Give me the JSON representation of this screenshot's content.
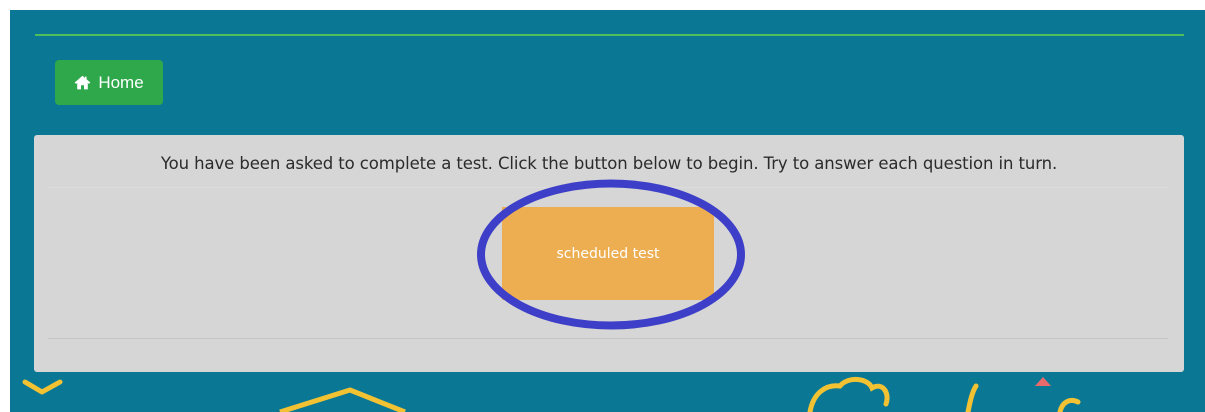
{
  "nav": {
    "home_label": "Home",
    "home_icon": "home-icon"
  },
  "panel": {
    "instruction": "You have been asked to complete a test. Click the button below to begin. Try to answer each question in turn.",
    "start_button_label": "scheduled test"
  },
  "colors": {
    "background": "#0a7895",
    "accent_green": "#2ea84a",
    "rule_green": "#52c05a",
    "panel": "#d6d6d6",
    "button_orange": "#edae52",
    "annotation_blue": "#3d3fc8",
    "decor_yellow": "#f2c232",
    "decor_pink": "#e86a6a"
  }
}
